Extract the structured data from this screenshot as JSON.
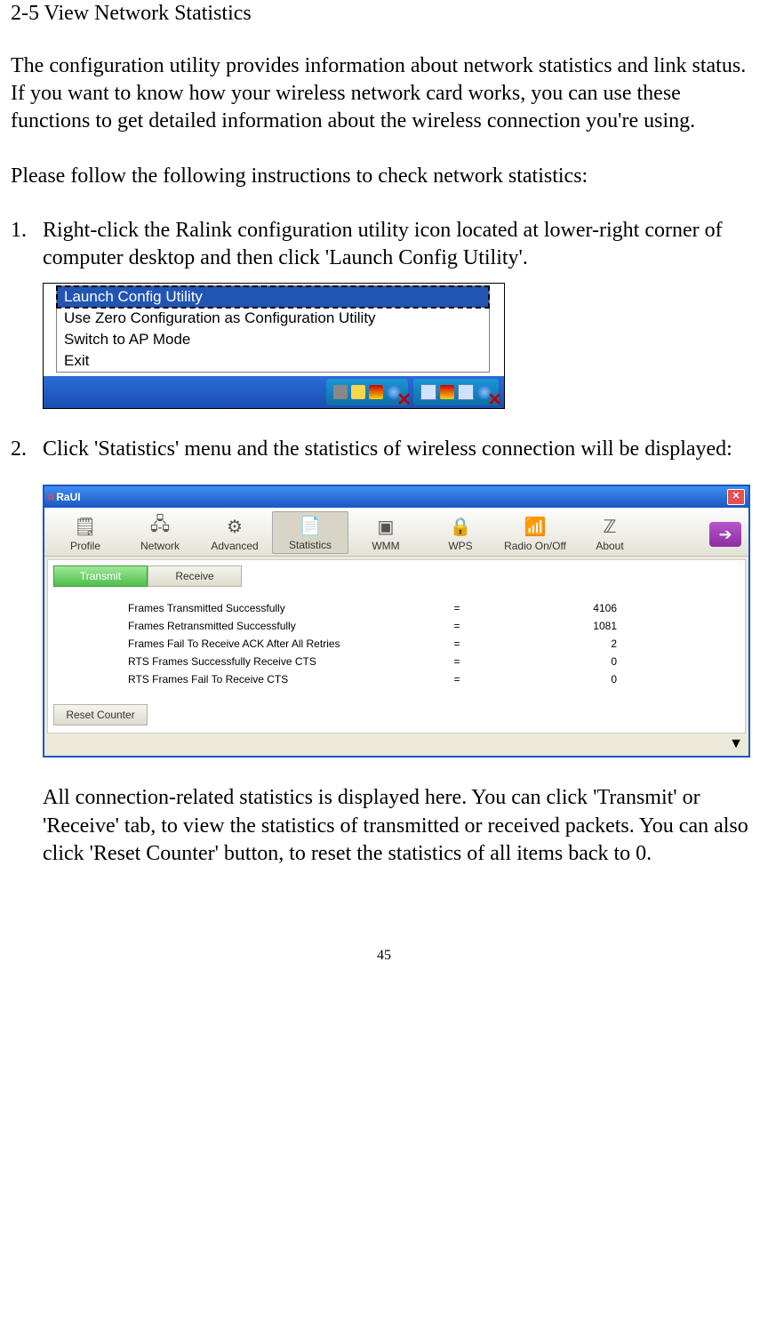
{
  "section_title": "2-5 View Network Statistics",
  "para_intro": "The configuration utility provides information about network statistics and link status. If you want to know how your wireless network card works, you can use these functions to get detailed information about the wireless connection you're using.",
  "para_follow": "Please follow the following instructions to check network statistics:",
  "steps": {
    "1": {
      "num": "1.",
      "text": "Right-click the Ralink configuration utility icon located at lower-right corner of computer desktop and then click 'Launch Config Utility'."
    },
    "2": {
      "num": "2.",
      "text": "Click 'Statistics' menu and the statistics of wireless connection will be displayed:"
    }
  },
  "context_menu": {
    "items": [
      "Launch Config Utility",
      "Use Zero Configuration as Configuration Utility",
      "Switch to AP Mode",
      "Exit"
    ]
  },
  "raui": {
    "title": "RaUI",
    "toolbar": [
      {
        "label": "Profile"
      },
      {
        "label": "Network"
      },
      {
        "label": "Advanced"
      },
      {
        "label": "Statistics"
      },
      {
        "label": "WMM"
      },
      {
        "label": "WPS"
      },
      {
        "label": "Radio On/Off"
      },
      {
        "label": "About"
      }
    ],
    "subtabs": {
      "transmit": "Transmit",
      "receive": "Receive"
    },
    "stats": [
      {
        "label": "Frames Transmitted Successfully",
        "value": "4106"
      },
      {
        "label": "Frames Retransmitted Successfully",
        "value": "1081"
      },
      {
        "label": "Frames Fail To Receive ACK After All Retries",
        "value": "2"
      },
      {
        "label": "RTS Frames Successfully Receive CTS",
        "value": "0"
      },
      {
        "label": "RTS Frames Fail To Receive CTS",
        "value": "0"
      }
    ],
    "reset_label": "Reset Counter"
  },
  "para_after": "All connection-related statistics is displayed here. You can click 'Transmit' or 'Receive' tab, to view the statistics of transmitted or received packets. You can also click 'Reset Counter' button, to reset the statistics of all items back to 0.",
  "page_number": "45",
  "eq": "="
}
